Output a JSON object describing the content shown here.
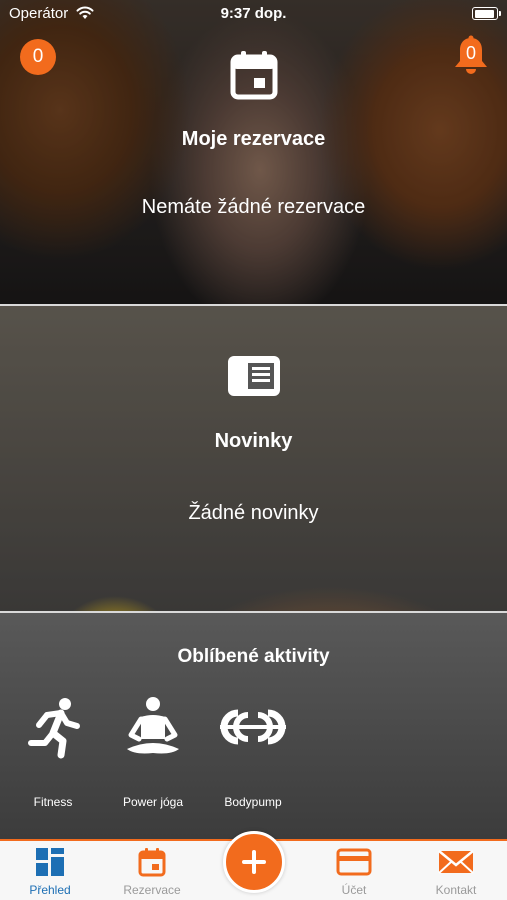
{
  "status": {
    "carrier": "Operátor",
    "time": "9:37 dop."
  },
  "badges": {
    "left_count": "0",
    "bell_count": "0"
  },
  "reservations": {
    "title": "Moje rezervace",
    "message": "Nemáte žádné rezervace",
    "icon": "calendar-icon"
  },
  "news": {
    "title": "Novinky",
    "message": "Žádné novinky",
    "icon": "news-icon"
  },
  "favorites": {
    "title": "Oblíbené aktivity",
    "items": [
      {
        "label": "Fitness",
        "icon": "running-person-icon"
      },
      {
        "label": "Power jóga",
        "icon": "meditation-icon"
      },
      {
        "label": "Bodypump",
        "icon": "barbell-icon"
      }
    ]
  },
  "tabbar": {
    "active": "overview",
    "items": [
      {
        "label": "Přehled",
        "icon": "dashboard-icon"
      },
      {
        "label": "Rezervace",
        "icon": "calendar-icon"
      },
      {
        "label": "",
        "icon": "plus-icon"
      },
      {
        "label": "Účet",
        "icon": "card-icon"
      },
      {
        "label": "Kontakt",
        "icon": "mail-icon"
      }
    ]
  },
  "colors": {
    "accent": "#f26b1d",
    "active_tab": "#1d6fb4",
    "inactive_tab": "#9a9a9a"
  }
}
